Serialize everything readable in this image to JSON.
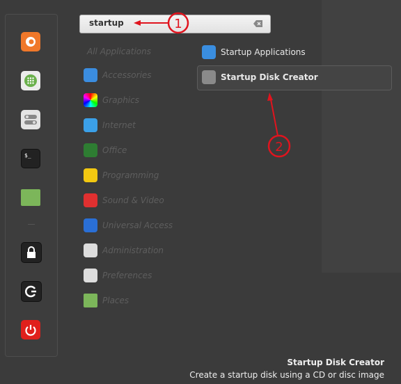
{
  "search": {
    "value": "startup",
    "clear_icon": "backspace-icon"
  },
  "favorites": [
    {
      "name": "firefox",
      "color": "#f0782a"
    },
    {
      "name": "software-manager",
      "color": "#ececec"
    },
    {
      "name": "system-settings",
      "color": "#e4e4e4"
    },
    {
      "name": "terminal",
      "color": "#222222",
      "label": "$_"
    },
    {
      "name": "files",
      "color": "#7cb65a"
    },
    {
      "name": "lock-screen",
      "color": "#222222"
    },
    {
      "name": "logout",
      "color": "#222222"
    },
    {
      "name": "shutdown",
      "color": "#e0201c"
    }
  ],
  "categories": [
    {
      "label": "All Applications"
    },
    {
      "label": "Accessories",
      "color": "#3b8de0"
    },
    {
      "label": "Graphics",
      "color": "#c030c0"
    },
    {
      "label": "Internet",
      "color": "#3ba0e8"
    },
    {
      "label": "Office",
      "color": "#2e7d32"
    },
    {
      "label": "Programming",
      "color": "#f2c811"
    },
    {
      "label": "Sound & Video",
      "color": "#e03030"
    },
    {
      "label": "Universal Access",
      "color": "#2a6fd6"
    },
    {
      "label": "Administration",
      "color": "#dddddd"
    },
    {
      "label": "Preferences",
      "color": "#dddddd"
    },
    {
      "label": "Places",
      "color": "#7cb65a"
    }
  ],
  "results": [
    {
      "label": "Startup Applications",
      "color": "#3a8ee0"
    },
    {
      "label": "Startup Disk Creator",
      "color": "#8a8a8a",
      "selected": true
    }
  ],
  "description": {
    "title": "Startup Disk Creator",
    "text": "Create a startup disk using a CD or disc image"
  },
  "annotations": [
    {
      "label": "1"
    },
    {
      "label": "2"
    }
  ],
  "accent": "#e0141e"
}
